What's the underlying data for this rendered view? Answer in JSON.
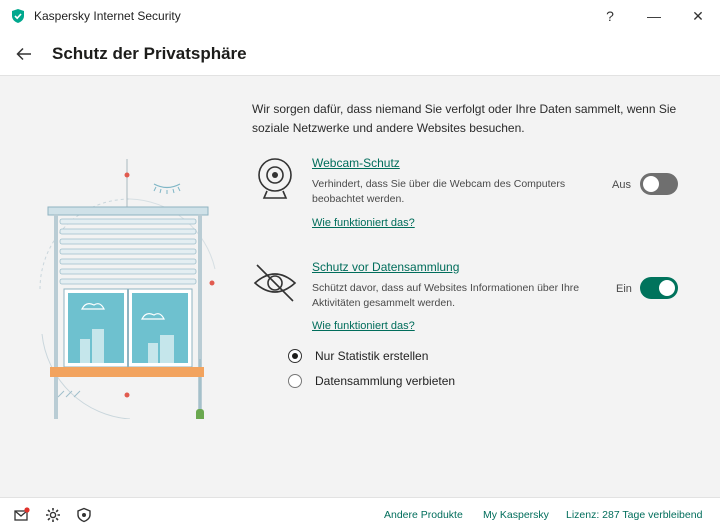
{
  "window": {
    "title": "Kaspersky Internet Security",
    "help_label": "?",
    "minimize_label": "—",
    "close_label": "✕"
  },
  "header": {
    "back_icon": "arrow-left-icon",
    "title": "Schutz der Privatsphäre"
  },
  "main": {
    "intro": "Wir sorgen dafür, dass niemand Sie verfolgt oder Ihre Daten sammelt, wenn Sie soziale Netzwerke und andere Websites besuchen.",
    "features": [
      {
        "icon": "webcam-icon",
        "title": "Webcam-Schutz",
        "description": "Verhindert, dass Sie über die Webcam des Computers beobachtet werden.",
        "how_link": "Wie funktioniert das?",
        "toggle_label": "Aus",
        "toggle_on": false
      },
      {
        "icon": "eye-crossed-icon",
        "title": "Schutz vor Datensammlung",
        "description": "Schützt davor, dass auf Websites Informationen über Ihre Aktivitäten gesammelt werden.",
        "how_link": "Wie funktioniert das?",
        "toggle_label": "Ein",
        "toggle_on": true
      }
    ],
    "options": [
      {
        "label": "Nur Statistik erstellen",
        "selected": true
      },
      {
        "label": "Datensammlung verbieten",
        "selected": false
      }
    ]
  },
  "footer": {
    "icons": [
      "mail-notification-icon",
      "gear-icon",
      "shield-support-icon"
    ],
    "links": {
      "products": "Andere Produkte",
      "account": "My Kaspersky",
      "license": "Lizenz: 287 Tage verbleibend"
    }
  },
  "colors": {
    "accent": "#00735c",
    "link": "#006d5b",
    "toggle_off": "#6f6f6f",
    "window_sill": "#f2a35e"
  }
}
